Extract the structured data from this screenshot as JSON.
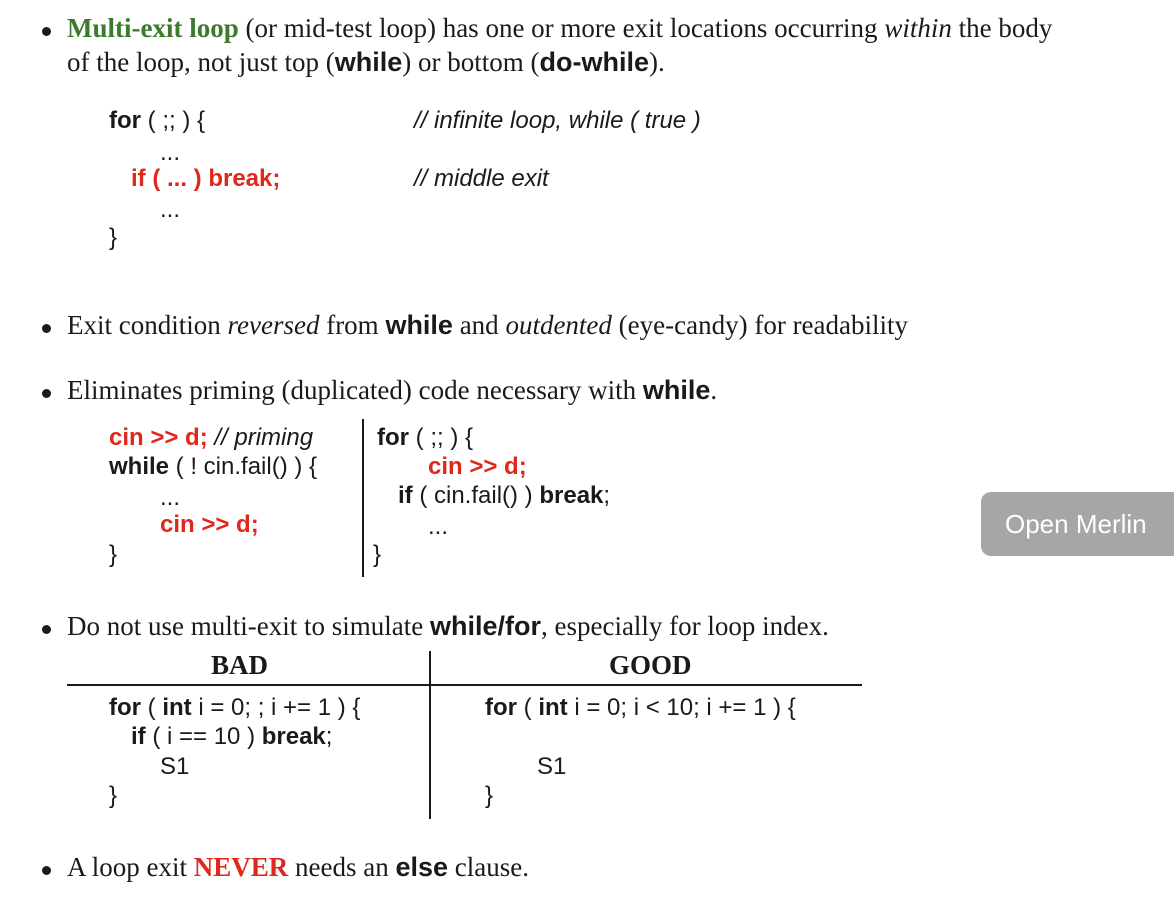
{
  "bullet1": {
    "term": "Multi-exit loop",
    "p1": " (or mid-test loop) has one or more exit locations occurring ",
    "within": "within",
    "p2": " the body",
    "line2a": "of the loop, not just top (",
    "kw_while": "while",
    "line2b": ") or bottom (",
    "kw_dowhile": "do-while",
    "line2c": ")."
  },
  "code1": {
    "for_kw": "for",
    "for_rest": " ( ;; ) {",
    "comment1": "// infinite loop, while ( true )",
    "dots1": "...",
    "if_break": "if ( ... ) break;",
    "comment2": "// middle exit",
    "dots2": "...",
    "close": "}"
  },
  "bullet2": {
    "p1": "Exit condition ",
    "reversed": "reversed",
    "p2": " from ",
    "kw_while": "while",
    "p3": " and ",
    "outdented": "outdented",
    "p4": " (eye-candy) for readability"
  },
  "bullet3": {
    "p1": "Eliminates priming (duplicated) code necessary with ",
    "kw_while": "while",
    "p2": "."
  },
  "code2_left": {
    "cin_d": "cin >> d;",
    "priming": " // priming",
    "while_kw": "while",
    "while_rest": " ( ! cin.fail() ) {",
    "dots": "...",
    "cin_d2": "cin >> d;",
    "close": "}"
  },
  "code2_right": {
    "for_kw": "for",
    "for_rest": " ( ;; ) {",
    "cin_d": "cin >> d;",
    "if_kw": "if",
    "if_mid": " ( cin.fail() ) ",
    "break_kw": "break",
    "semi": ";",
    "dots": "...",
    "close": "}"
  },
  "bullet4": {
    "p1": "Do not use multi-exit to simulate ",
    "kw": "while/for",
    "p2": ", especially for loop index."
  },
  "table": {
    "bad_header": "BAD",
    "good_header": "GOOD",
    "bad": {
      "for_kw": "for",
      "p1": " ( ",
      "int_kw": "int",
      "p2": " i = 0; ; i += 1 ) {",
      "if_kw": "if",
      "p3": " ( i == 10 ) ",
      "break_kw": "break",
      "semi": ";",
      "s1": "S1",
      "close": "}"
    },
    "good": {
      "for_kw": "for",
      "p1": " ( ",
      "int_kw": "int",
      "p2": " i = 0; i < 10; i += 1 ) {",
      "s1": "S1",
      "close": "}"
    }
  },
  "bullet5": {
    "p1": "A loop exit ",
    "never": "NEVER",
    "p2": " needs an ",
    "kw_else": "else",
    "p3": " clause."
  },
  "merlin_button": "Open Merlin"
}
